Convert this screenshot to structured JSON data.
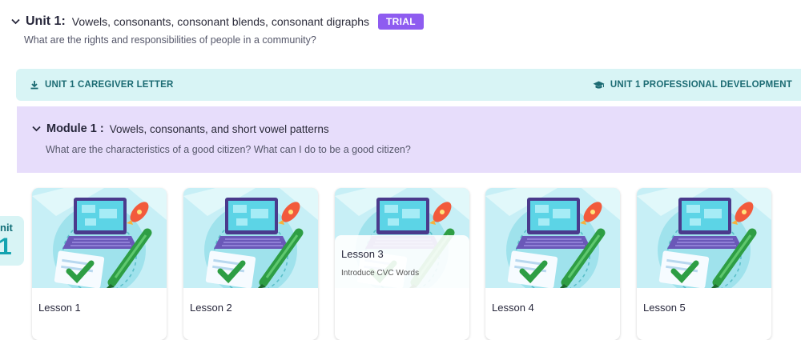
{
  "unit": {
    "number_label": "Unit 1:",
    "title": "Vowels, consonants, consonant blends, consonant digraphs",
    "badge": "TRIAL",
    "question": "What are the rights and responsibilities of people in a community?"
  },
  "resources": {
    "caregiver_letter": "UNIT 1 CAREGIVER LETTER",
    "professional_development": "UNIT 1 PROFESSIONAL DEVELOPMENT"
  },
  "module": {
    "number_label": "Module 1 :",
    "title": "Vowels, consonants, and short vowel patterns",
    "question": "What are the characteristics of a good citizen? What can I do to be a good citizen?"
  },
  "side_tab": {
    "line1": "nit",
    "line2": "1"
  },
  "lessons": [
    {
      "label": "Lesson 1"
    },
    {
      "label": "Lesson 2"
    },
    {
      "label": "Lesson 3",
      "subtitle": "Introduce CVC Words"
    },
    {
      "label": "Lesson 4"
    },
    {
      "label": "Lesson 5"
    }
  ],
  "colors": {
    "trial": "#8e5cf0",
    "resource_bar": "#d8f4f5",
    "resource_text": "#1c6b73",
    "module_bg": "#e7ddfb"
  }
}
